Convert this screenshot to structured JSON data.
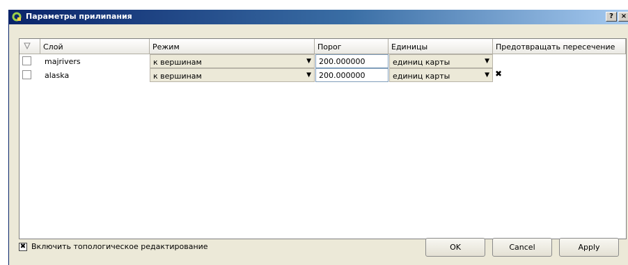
{
  "window": {
    "title": "Параметры прилипания",
    "help_label": "?",
    "close_label": "×"
  },
  "table": {
    "columns": [
      "Слой",
      "Режим",
      "Порог",
      "Единицы",
      "Предотвращать пересечение"
    ],
    "rows": [
      {
        "layer": "majrivers",
        "mode": "к вершинам",
        "threshold": "200.000000",
        "units": "единиц карты",
        "avoid_intersections": false
      },
      {
        "layer": "alaska",
        "mode": "к вершинам",
        "threshold": "200.000000",
        "units": "единиц карты",
        "avoid_intersections": true
      }
    ]
  },
  "footer": {
    "topology_label": "Включить топологическое редактирование",
    "topology_checked": true,
    "ok_label": "OK",
    "cancel_label": "Cancel",
    "apply_label": "Apply"
  },
  "colors": {
    "titlebar_start": "#0a246a",
    "titlebar_end": "#a6caf0",
    "dialog_bg": "#ece9d8"
  },
  "icons": {
    "title_icon": "qgis-logo-icon",
    "corner_icon": "filter-triangle-icon",
    "check_icon": "x-check-icon",
    "dropdown_icon": "triangle-down-icon"
  }
}
